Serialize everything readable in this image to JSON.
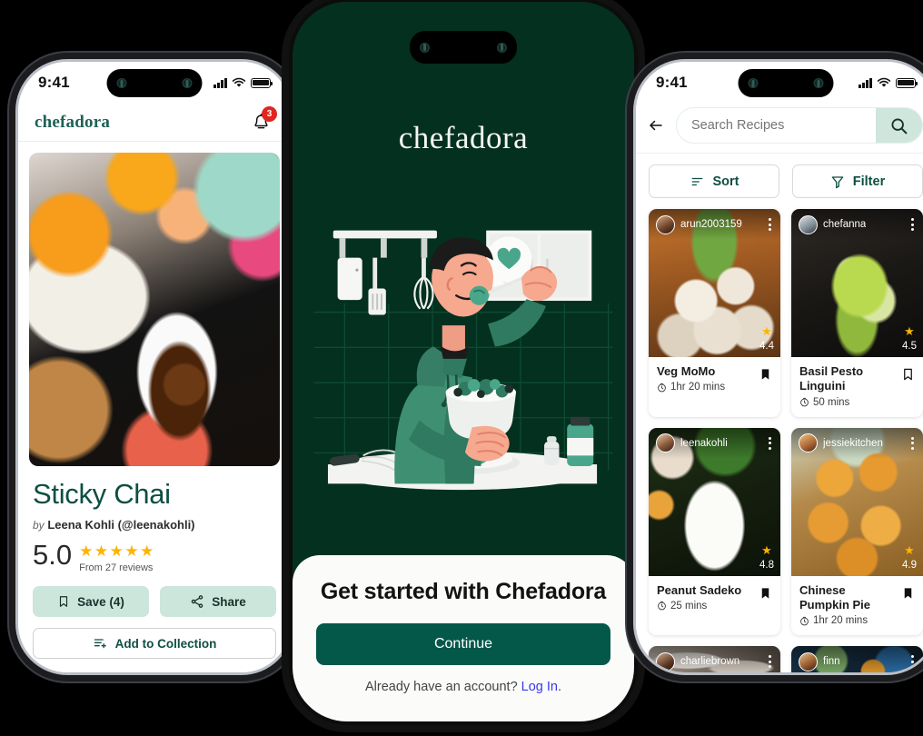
{
  "left_phone": {
    "status": {
      "time": "9:41",
      "signal_icon": "cellular-bars-icon",
      "wifi_icon": "wifi-icon",
      "battery_icon": "battery-icon"
    },
    "header": {
      "brand": "chefadora",
      "bell_icon": "notification-bell-icon",
      "badge_count": "3"
    },
    "hero": {
      "image_name": "sticky-chai-hero-photo"
    },
    "recipe": {
      "title": "Sticky Chai",
      "by_prefix": "by",
      "author": "Leena Kohli (@leenakohli)",
      "rating_value": "5.0",
      "stars": "★★★★★",
      "reviews": "From 27 reviews"
    },
    "actions": {
      "save_label": "Save (4)",
      "save_icon": "bookmark-icon",
      "share_label": "Share",
      "share_icon": "share-icon",
      "collection_label": "Add to Collection",
      "collection_icon": "add-to-list-icon"
    }
  },
  "mid_phone": {
    "logo": "chefadora",
    "illustration_name": "man-eating-salad-kitchen-illustration",
    "sheet": {
      "title": "Get started with Chefadora",
      "continue_label": "Continue",
      "account_text": "Already have an account? ",
      "login_label": "Log In",
      "period": "."
    }
  },
  "right_phone": {
    "status": {
      "time": "9:41",
      "signal_icon": "cellular-bars-icon",
      "wifi_icon": "wifi-icon",
      "battery_icon": "battery-icon"
    },
    "search": {
      "back_icon": "back-arrow-icon",
      "placeholder": "Search Recipes",
      "value": "",
      "search_icon": "search-icon"
    },
    "controls": {
      "sort_label": "Sort",
      "sort_icon": "sort-icon",
      "filter_label": "Filter",
      "filter_icon": "filter-funnel-icon"
    },
    "cards": [
      {
        "username": "arun2003159",
        "title": "Veg MoMo",
        "time": "1hr 20 mins",
        "rating": "4.4",
        "avatar_class": "av-a",
        "photo_class": "ph-momo",
        "bookmark_icon": "bookmark-filled-icon",
        "clock_icon": "clock-icon",
        "star_icon": "star-icon",
        "menu_icon": "kebab-menu-icon"
      },
      {
        "username": "chefanna",
        "title": "Basil Pesto Linguini",
        "time": "50 mins",
        "rating": "4.5",
        "avatar_class": "av-b",
        "photo_class": "ph-pesto",
        "bookmark_icon": "bookmark-outline-icon",
        "clock_icon": "clock-icon",
        "star_icon": "star-icon",
        "menu_icon": "kebab-menu-icon"
      },
      {
        "username": "leenakohli",
        "title": "Peanut Sadeko",
        "time": "25 mins",
        "rating": "4.8",
        "avatar_class": "av-c",
        "photo_class": "ph-sadeko",
        "bookmark_icon": "bookmark-filled-icon",
        "clock_icon": "clock-icon",
        "star_icon": "star-icon",
        "menu_icon": "kebab-menu-icon"
      },
      {
        "username": "jessiekitchen",
        "title": "Chinese Pumpkin Pie",
        "time": "1hr 20 mins",
        "rating": "4.9",
        "avatar_class": "av-d",
        "photo_class": "ph-pumpkin",
        "bookmark_icon": "bookmark-filled-icon",
        "clock_icon": "clock-icon",
        "star_icon": "star-icon",
        "menu_icon": "kebab-menu-icon"
      }
    ],
    "partial_cards": [
      {
        "username": "charliebrown",
        "avatar_class": "av-e",
        "photo_class": "ph-marble",
        "menu_icon": "kebab-menu-icon"
      },
      {
        "username": "finn",
        "avatar_class": "av-f",
        "photo_class": "ph-blue",
        "menu_icon": "kebab-menu-icon"
      }
    ]
  },
  "colors": {
    "brand_green": "#1f6157",
    "deep_green": "#04301f",
    "button_green": "#04584a",
    "mint": "#cce6dc",
    "star_gold": "#FFB300",
    "badge_red": "#e0261f",
    "link_blue": "#3b37ef"
  }
}
